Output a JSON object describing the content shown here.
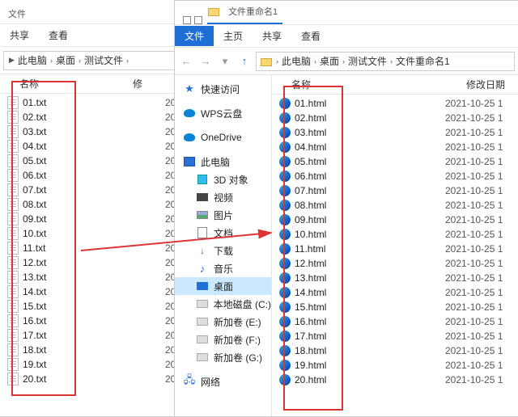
{
  "left_window": {
    "title_suffix": "文件",
    "ribbon": {
      "share": "共享",
      "view": "查看"
    },
    "crumbs": [
      "此电脑",
      "桌面",
      "测试文件"
    ],
    "columns": {
      "name": "名称",
      "date": "修"
    },
    "date_prefix": "20",
    "files": [
      "01.txt",
      "02.txt",
      "03.txt",
      "04.txt",
      "05.txt",
      "06.txt",
      "07.txt",
      "08.txt",
      "09.txt",
      "10.txt",
      "11.txt",
      "12.txt",
      "13.txt",
      "14.txt",
      "15.txt",
      "16.txt",
      "17.txt",
      "18.txt",
      "19.txt",
      "20.txt"
    ]
  },
  "right_window": {
    "title": "文件重命名1",
    "ribbon": {
      "file": "文件",
      "home": "主页",
      "share": "共享",
      "view": "查看"
    },
    "crumbs": [
      "此电脑",
      "桌面",
      "测试文件",
      "文件重命名1"
    ],
    "columns": {
      "name": "名称",
      "date": "修改日期"
    },
    "date_value": "2021-10-25 1",
    "navpane": {
      "quick": "快速访问",
      "wps": "WPS云盘",
      "onedrive": "OneDrive",
      "thispc": "此电脑",
      "pc_children": [
        {
          "label": "3D 对象",
          "icon": "i-3d"
        },
        {
          "label": "视频",
          "icon": "i-vid"
        },
        {
          "label": "图片",
          "icon": "i-img"
        },
        {
          "label": "文档",
          "icon": "i-doc"
        },
        {
          "label": "下载",
          "icon": "i-down",
          "glyph": "↓"
        },
        {
          "label": "音乐",
          "icon": "i-music",
          "glyph": "♪"
        },
        {
          "label": "桌面",
          "icon": "i-desktop",
          "selected": true
        },
        {
          "label": "本地磁盘 (C:)",
          "icon": "i-drive"
        },
        {
          "label": "新加卷 (E:)",
          "icon": "i-drive"
        },
        {
          "label": "新加卷 (F:)",
          "icon": "i-drive"
        },
        {
          "label": "新加卷 (G:)",
          "icon": "i-drive"
        }
      ],
      "network": "网络"
    },
    "files": [
      "01.html",
      "02.html",
      "03.html",
      "04.html",
      "05.html",
      "06.html",
      "07.html",
      "08.html",
      "09.html",
      "10.html",
      "11.html",
      "12.html",
      "13.html",
      "14.html",
      "15.html",
      "16.html",
      "17.html",
      "18.html",
      "19.html",
      "20.html"
    ]
  }
}
